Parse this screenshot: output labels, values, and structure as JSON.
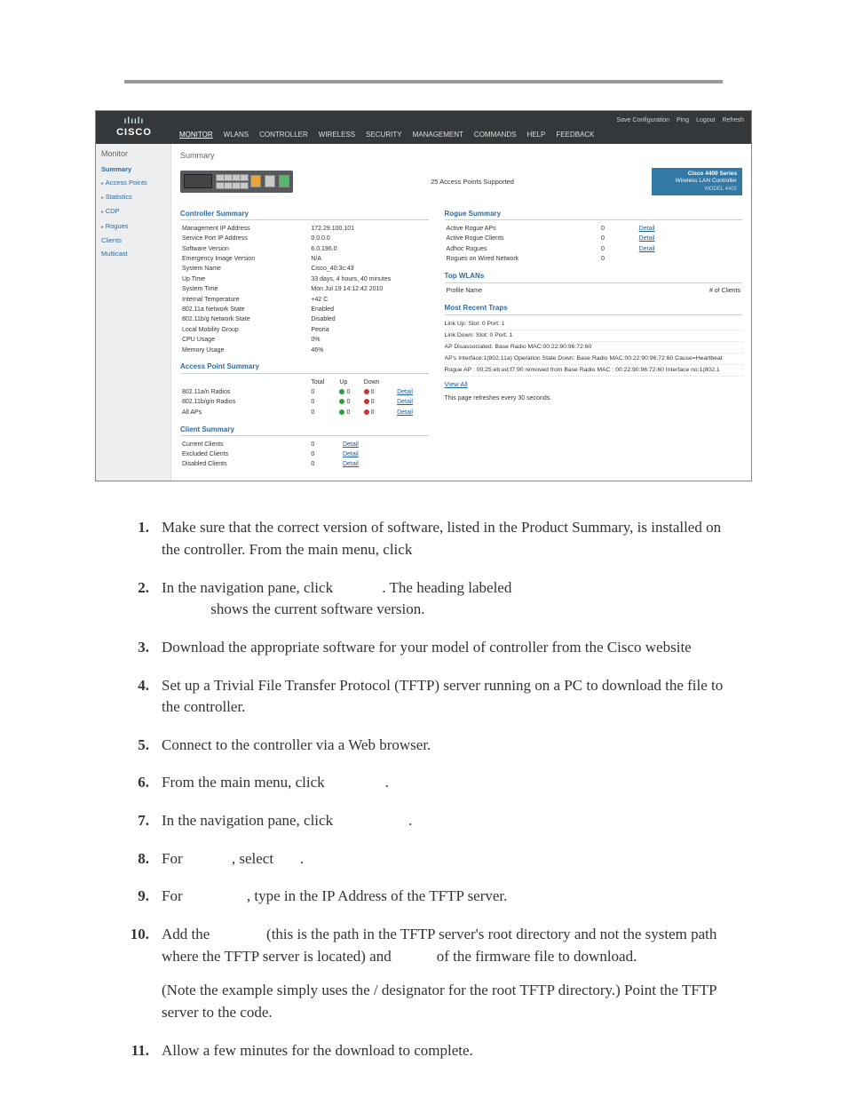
{
  "header": {
    "brand_top": "ılıılı",
    "brand": "CISCO",
    "top_links": [
      "Save Configuration",
      "Ping",
      "Logout",
      "Refresh"
    ],
    "menu": [
      "MONITOR",
      "WLANs",
      "CONTROLLER",
      "WIRELESS",
      "SECURITY",
      "MANAGEMENT",
      "COMMANDS",
      "HELP",
      "FEEDBACK"
    ]
  },
  "sidebar": {
    "title": "Monitor",
    "items": [
      {
        "label": "Summary",
        "selected": true,
        "caret": false
      },
      {
        "label": "Access Points",
        "selected": false,
        "caret": true
      },
      {
        "label": "Statistics",
        "selected": false,
        "caret": true
      },
      {
        "label": "CDP",
        "selected": false,
        "caret": true
      },
      {
        "label": "Rogues",
        "selected": false,
        "caret": true
      },
      {
        "label": "Clients",
        "selected": false,
        "caret": false
      },
      {
        "label": "Multicast",
        "selected": false,
        "caret": false
      }
    ]
  },
  "content": {
    "page_heading": "Summary",
    "aps_supported": "25 Access Points Supported",
    "badge_title": "Cisco 4400 Series",
    "badge_sub": "Wireless LAN Controller",
    "badge_model": "MODEL 4402",
    "controller_summary_title": "Controller Summary",
    "controller_summary": [
      [
        "Management IP Address",
        "172.29.100.101"
      ],
      [
        "Service Port IP Address",
        "0.0.0.0"
      ],
      [
        "Software Version",
        "6.0.196.0"
      ],
      [
        "Emergency Image Version",
        "N/A"
      ],
      [
        "System Name",
        "Cisco_40:3c:43"
      ],
      [
        "Up Time",
        "33 days, 4 hours, 40 minutes"
      ],
      [
        "System Time",
        "Mon Jul 19 14:12:42 2010"
      ],
      [
        "Internal Temperature",
        "+42 C"
      ],
      [
        "802.11a Network State",
        "Enabled"
      ],
      [
        "802.11b/g Network State",
        "Disabled"
      ],
      [
        "Local Mobility Group",
        "Peoria"
      ],
      [
        "CPU Usage",
        "0%"
      ],
      [
        "Memory Usage",
        "46%"
      ]
    ],
    "ap_summary_title": "Access Point Summary",
    "ap_summary_headers": [
      "",
      "Total",
      "Up",
      "Down",
      ""
    ],
    "ap_summary_rows": [
      [
        "802.11a/n Radios",
        "0",
        "g0",
        "r0",
        "Detail"
      ],
      [
        "802.11b/g/n Radios",
        "0",
        "g0",
        "r0",
        "Detail"
      ],
      [
        "All APs",
        "0",
        "g0",
        "r0",
        "Detail"
      ]
    ],
    "client_summary_title": "Client Summary",
    "client_summary_rows": [
      [
        "Current Clients",
        "0",
        "Detail"
      ],
      [
        "Excluded Clients",
        "0",
        "Detail"
      ],
      [
        "Disabled Clients",
        "0",
        "Detail"
      ]
    ],
    "rogue_summary_title": "Rogue Summary",
    "rogue_summary_rows": [
      [
        "Active Rogue APs",
        "0",
        "Detail"
      ],
      [
        "Active Rogue Clients",
        "0",
        "Detail"
      ],
      [
        "Adhoc Rogues",
        "0",
        "Detail"
      ],
      [
        "Rogues on Wired Network",
        "0",
        ""
      ]
    ],
    "top_wlans_title": "Top WLANs",
    "top_wlans_headers": [
      "Profile Name",
      "# of Clients"
    ],
    "recent_traps_title": "Most Recent Traps",
    "recent_traps": [
      "Link Up: Slot: 0 Port: 1",
      "Link Down: Slot: 0 Port: 1",
      "AP Disassociated. Base Radio MAC:00:22:90:96:72:60",
      "AP's Interface:1(802.11a) Operation State Down: Base Radio MAC:00:22:90:96:72:60 Cause=Heartbeat",
      "Rogue AP : 00:25:eb:ed:f7:90 removed from Base Radio MAC : 00:22:90:96:72:60 Interface no:1(802.1"
    ],
    "view_all": "View All",
    "refresh_note": "This page refreshes every 30 seconds."
  },
  "steps": {
    "s1": "Make sure that the correct version of software, listed in the Product Summary, is installed on the controller. From the main menu, click",
    "s2a": "In the navigation pane, click",
    "s2b": ". The heading labeled",
    "s2c": "shows the current software version.",
    "s3": "Download the appropriate software for your model of controller from the Cisco website",
    "s4": "Set up a Trivial File Transfer Protocol (TFTP) server running on a PC to download the file to the controller.",
    "s5": "Connect to the controller via a Web browser.",
    "s6": "From the main menu, click",
    "s7": "In the navigation pane, click",
    "s8a": "For",
    "s8b": ", select",
    "s9a": "For",
    "s9b": ", type in the IP Address of the TFTP server.",
    "s10a": "Add the",
    "s10b": "(this is the path in the TFTP server's root directory and not the system path where the TFTP server is located) and",
    "s10c": "of the firmware file to download.",
    "s10d": "(Note the example simply uses the / designator for the root TFTP directory.) Point the TFTP server to the code.",
    "s11": "Allow a few minutes for the download to complete.",
    "period": "."
  }
}
